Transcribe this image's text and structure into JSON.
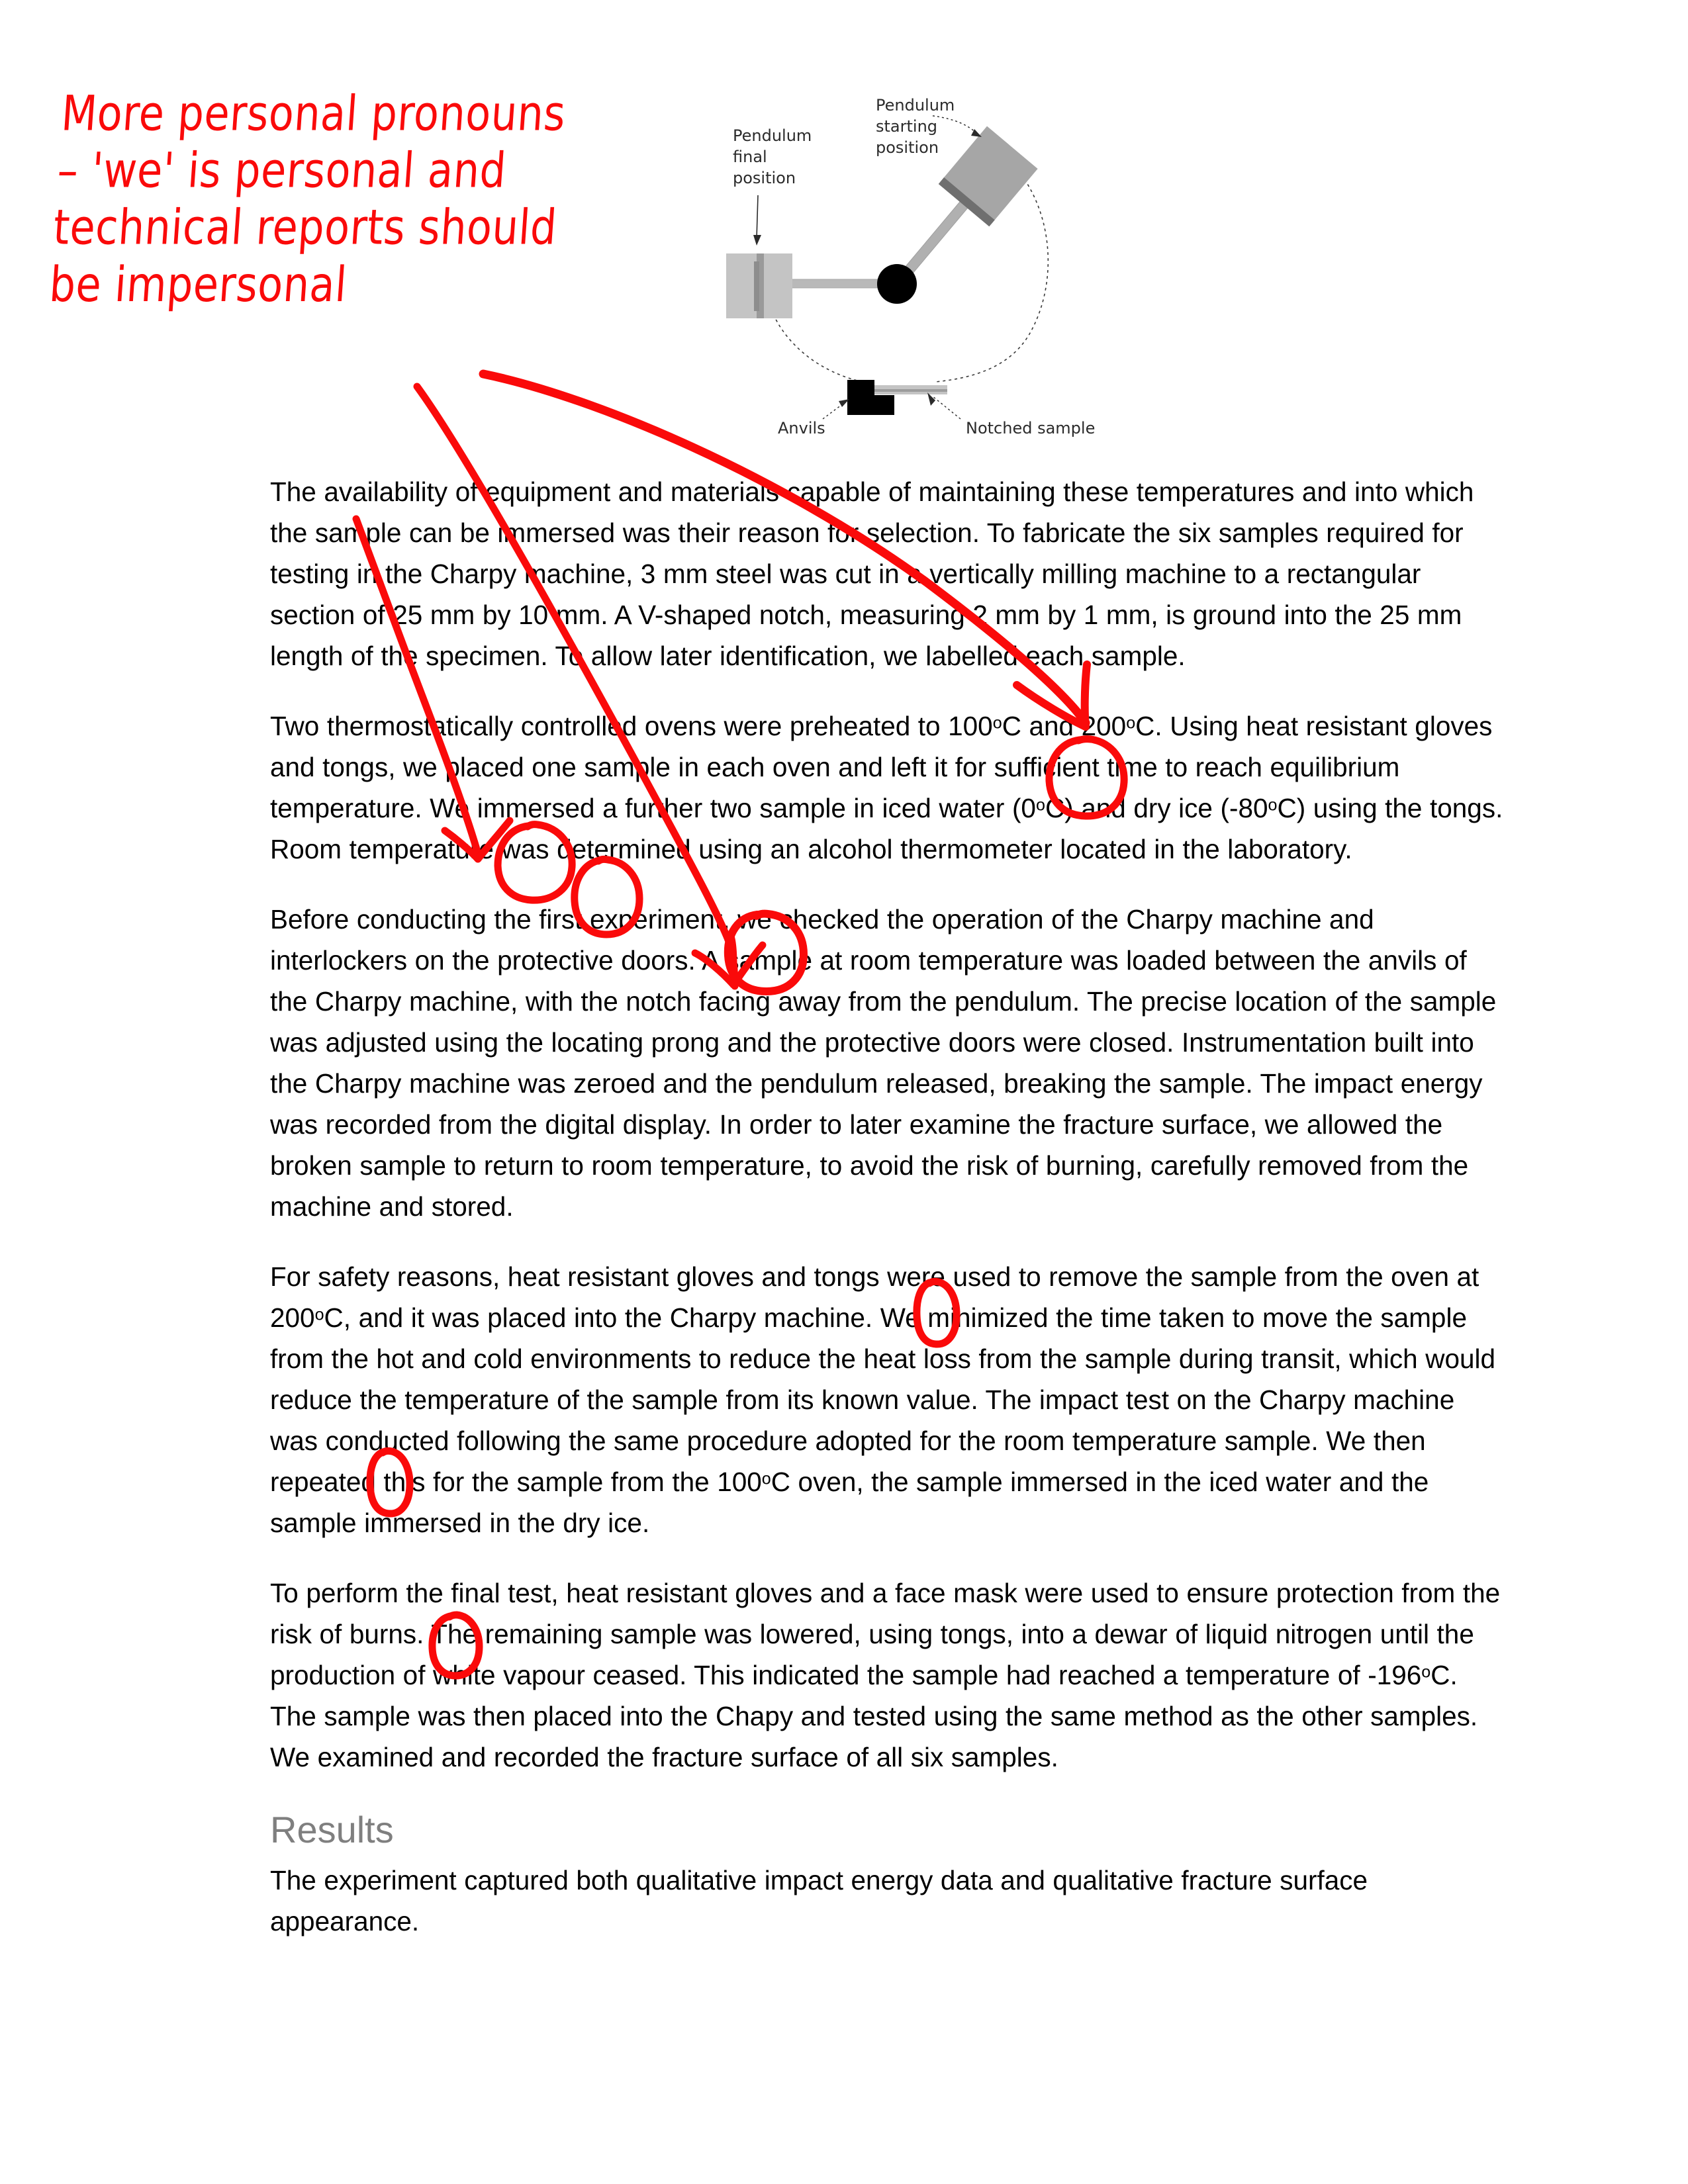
{
  "annotation": {
    "text": "More personal pronouns\n– 'we' is personal and\ntechnical reports should\nbe impersonal",
    "color": "#fa0a0a"
  },
  "figure": {
    "name": "charpy-impact-test-diagram",
    "labels": {
      "pendulum_final_position": "Pendulum\nfinal\nposition",
      "pendulum_final_line1": "Pendulum",
      "pendulum_final_line2": "final",
      "pendulum_final_line3": "position",
      "pendulum_start_line1": "Pendulum",
      "pendulum_start_line2": "starting",
      "pendulum_start_line3": "position",
      "anvils": "Anvils",
      "notched_sample": "Notched sample"
    }
  },
  "document": {
    "paragraphs": [
      {
        "id": "p1",
        "segments": [
          {
            "t": "The availability of equipment and materials capable of maintaining these temperatures and into which the sample can be immersed was their reason for selection. To fabricate the six samples required for testing in the Charpy machine, 3 mm steel was cut in a vertically milling machine to a rectangular section of 25 mm by 10 mm. A V-shaped notch, measuring 2 mm by 1 mm, is ground into the 25 mm length of the specimen. To allow later identification, we labelled each sample."
          }
        ]
      },
      {
        "id": "p2",
        "segments": [
          {
            "t": "Two thermostatically controlled ovens were preheated to 100"
          },
          {
            "t": "o",
            "sup": true
          },
          {
            "t": "C and 200"
          },
          {
            "t": "o",
            "sup": true
          },
          {
            "t": "C. Using heat resistant gloves and tongs, we placed one sample in each oven and left it for sufficient time to reach equilibrium temperature. We immersed a further two sample in iced water (0"
          },
          {
            "t": "o",
            "sup": true
          },
          {
            "t": "C) and dry ice (-80"
          },
          {
            "t": "o",
            "sup": true
          },
          {
            "t": "C) using the tongs. Room temperature was determined using an alcohol thermometer located in the laboratory."
          }
        ]
      },
      {
        "id": "p3",
        "segments": [
          {
            "t": "Before conducting the first experiment, we checked the operation of the Charpy machine and interlockers on the protective doors. A sample at room temperature was loaded between the anvils of the Charpy machine, with the notch facing away from the pendulum. The precise location of the sample was adjusted using the locating prong and the protective doors were closed. Instrumentation built into the Charpy machine was zeroed and the pendulum released, breaking the sample. The impact energy was recorded from the digital display. In order to later examine the fracture surface, we allowed the broken sample to return to room temperature, to avoid the risk of burning, carefully removed from the machine and stored."
          }
        ]
      },
      {
        "id": "p4",
        "segments": [
          {
            "t": "For safety reasons, heat resistant gloves and tongs were used to remove the sample from the oven at 200"
          },
          {
            "t": "o",
            "sup": true
          },
          {
            "t": "C, and it was placed into the Charpy machine. We minimized the time taken to move the sample from the hot and cold environments to reduce the heat loss from the sample during transit, which would reduce the temperature of the sample from its known value. The impact test on the Charpy machine was conducted following the same procedure adopted for the room temperature sample. We then repeated this for the sample from the 100"
          },
          {
            "t": "o",
            "sup": true
          },
          {
            "t": "C oven, the sample immersed in the iced water and the sample immersed in the dry ice."
          }
        ]
      },
      {
        "id": "p5",
        "segments": [
          {
            "t": "To perform the final test, heat resistant gloves and a face mask were used to ensure protection from the risk of burns. The remaining sample was lowered, using tongs, into a dewar of liquid nitrogen until the production of white vapour ceased. This indicated the sample had reached a temperature of -196"
          },
          {
            "t": "o",
            "sup": true
          },
          {
            "t": "C. The sample was then placed into the Chapy and tested using the same method as the other samples. We examined and recorded the fracture surface of all six samples."
          }
        ]
      }
    ],
    "results_heading": "Results",
    "results_paragraph": [
      {
        "t": "The experiment captured both qualitative impact energy data and qualitative fracture surface appearance."
      }
    ]
  },
  "ink_marks": {
    "color": "#fa0a0a",
    "circled_phrases": [
      "we labelled",
      "we placed",
      "We immersed",
      "we checked",
      "We minimized",
      "We then",
      "We examined"
    ],
    "arrow_count": 3
  }
}
